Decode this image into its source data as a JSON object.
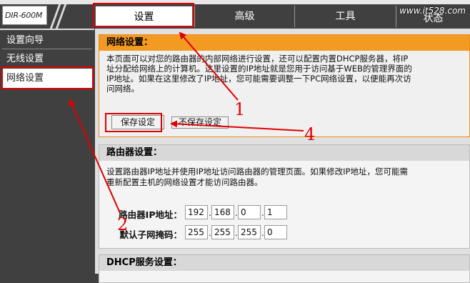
{
  "header": {
    "logo": "DIR-600M",
    "tabs": [
      {
        "label": "设置"
      },
      {
        "label": "高级"
      },
      {
        "label": "工具"
      },
      {
        "label": "状态"
      }
    ],
    "watermark": "www.it528.com"
  },
  "sidebar": {
    "items": [
      {
        "label": "设置向导"
      },
      {
        "label": "无线设置"
      },
      {
        "label": "网络设置"
      }
    ]
  },
  "network_panel": {
    "title": "网络设置：",
    "description_lines": [
      "本页面可以对您的路由器的内部网络进行设置，还可以配置内置DHCP服务器，将IP",
      "址分配给网络上的计算机。这里设置的IP地址就是您用于访问基于WEB的管理界面的",
      "IP地址。如果在这里修改了IP地址，您可能需要调整一下PC网络设置，以便能再次访",
      "问网络。"
    ],
    "save_button": "保存设定",
    "dont_save_button": "不保存设定"
  },
  "router_panel": {
    "title": "路由器设置：",
    "description_lines": [
      "设置路由器IP地址并使用IP地址访问路由器的管理页面。如果修改IP地址，您可能需",
      "重新配置主机的网络设置才能访问路由器。"
    ],
    "ip_label": "路由器IP地址：",
    "ip_octets": [
      "192",
      "168",
      "0",
      "1"
    ],
    "mask_label": "默认子网掩码：",
    "mask_octets": [
      "255",
      "255",
      "255",
      "0"
    ]
  },
  "dhcp_panel": {
    "title": "DHCP服务设置："
  },
  "annotations": {
    "numbers": [
      "1",
      "2",
      "4"
    ],
    "color": "#e00000"
  }
}
